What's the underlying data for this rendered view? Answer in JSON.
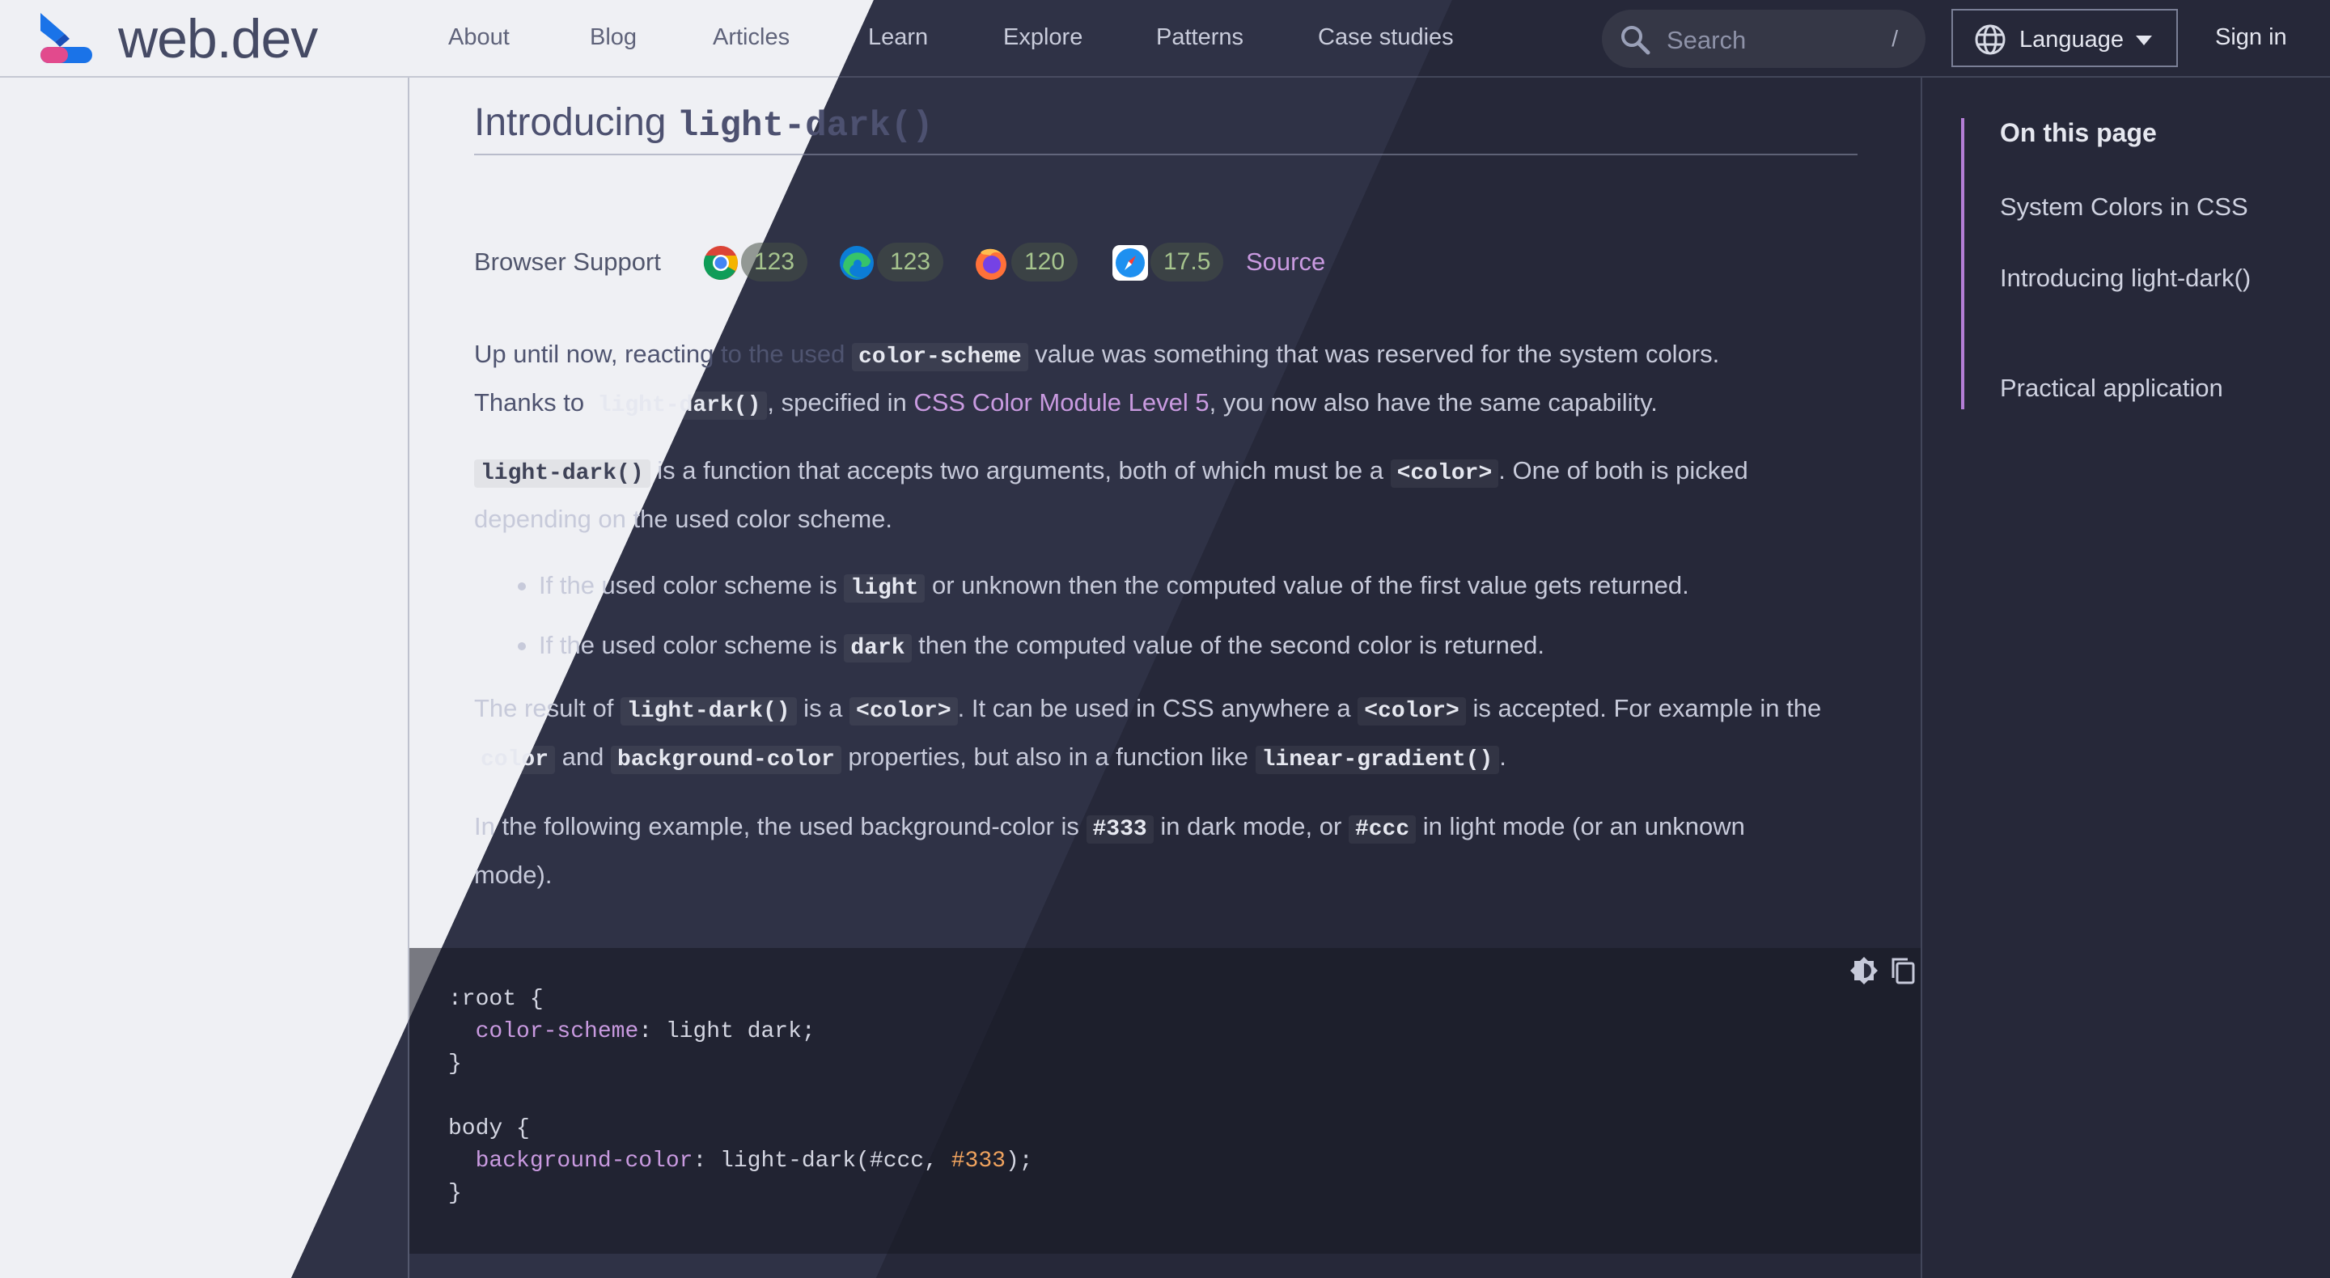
{
  "header": {
    "brand": "web.dev",
    "nav": [
      "About",
      "Blog",
      "Articles",
      "Learn",
      "Explore",
      "Patterns",
      "Case studies"
    ],
    "search_placeholder": "Search",
    "search_shortcut": "/",
    "language_label": "Language",
    "signin_label": "Sign in"
  },
  "article": {
    "heading_prefix": "Introducing ",
    "heading_code": "light-dark()",
    "support_label": "Browser Support",
    "browsers": [
      {
        "name": "chrome",
        "version": "123"
      },
      {
        "name": "edge",
        "version": "123"
      },
      {
        "name": "firefox",
        "version": "120"
      },
      {
        "name": "safari",
        "version": "17.5"
      }
    ],
    "source_label": "Source",
    "p1": {
      "t1": "Up until now, reacting to the used ",
      "c1": "color-scheme",
      "t2": " value was something that was reserved for the system colors.",
      "t3": "Thanks to ",
      "c2": "light-dark()",
      "t4": ", specified in ",
      "link": "CSS Color Module Level 5",
      "t5": ", you now also have the same capability."
    },
    "p2": {
      "c1": "light-dark()",
      "t1": " is a function that accepts two arguments, both of which must be a ",
      "c2": "<color>",
      "t2": ". One of both is picked",
      "t3": "depending on the used color scheme."
    },
    "li1": {
      "t1": "If the used color scheme is ",
      "c1": "light",
      "t2": " or unknown then the computed value of the first value gets returned."
    },
    "li2": {
      "t1": "If the used color scheme is ",
      "c1": "dark",
      "t2": " then the computed value of the second color is returned."
    },
    "p3": {
      "t1": "The result of ",
      "c1": "light-dark()",
      "t2": " is a ",
      "c2": "<color>",
      "t3": ". It can be used in CSS anywhere a ",
      "c3": "<color>",
      "t4": " is accepted. For example in the",
      "c4": "color",
      "t5": " and ",
      "c5": "background-color",
      "t6": " properties, but also in a function like ",
      "c6": "linear-gradient()",
      "t7": "."
    },
    "p4": {
      "t1": "In the following example, the used background-color is ",
      "c1": "#333",
      "t2": " in dark mode, or ",
      "c2": "#ccc",
      "t3": " in light mode (or an unknown",
      "t4": "mode)."
    },
    "code": {
      "l1": ":root {",
      "l2_prop": "color-scheme",
      "l2_rest": ": light dark;",
      "l3": "}",
      "l5": "body {",
      "l6_prop": "background-color",
      "l6_mid": ": light-dark(#ccc, ",
      "l6_num": "#333",
      "l6_end": ");",
      "l7": "}"
    }
  },
  "toc": {
    "title": "On this page",
    "items": [
      "System Colors in CSS",
      "Introducing light-dark()",
      "Practical application"
    ]
  },
  "colors": {
    "accent": "#c99ae0",
    "light_bg": "#eff0f4",
    "dark_bg": "#1f2030"
  }
}
